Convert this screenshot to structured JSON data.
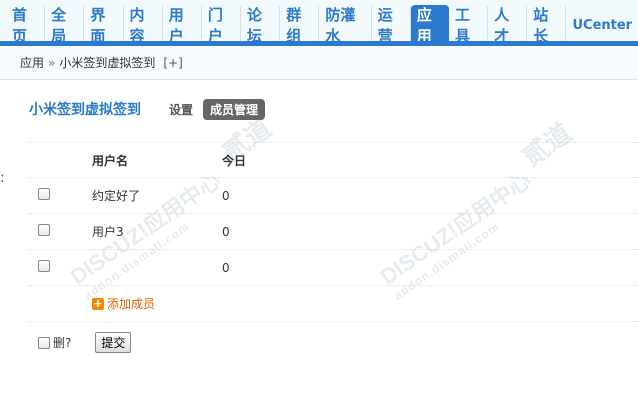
{
  "nav": {
    "tabs": [
      "首页",
      "全局",
      "界面",
      "内容",
      "用户",
      "门户",
      "论坛",
      "群组",
      "防灌水",
      "运营",
      "应用",
      "工具",
      "人才",
      "站长",
      "UCenter"
    ],
    "active_index": 10
  },
  "breadcrumb": {
    "root": "应用",
    "separator": "»",
    "current": "小米签到虚拟签到",
    "add": "[+]"
  },
  "header": {
    "title": "小米签到虚拟签到",
    "tabs": [
      "设置",
      "成员管理"
    ],
    "active_tab": "成员管理"
  },
  "table": {
    "columns": [
      "用户名",
      "今日"
    ],
    "rows": [
      {
        "username": "约定好了",
        "today": "0"
      },
      {
        "username": "用户3",
        "today": "0"
      },
      {
        "username": "",
        "today": "0"
      }
    ]
  },
  "add_member": "添加成员",
  "footer": {
    "delete_label": "删?",
    "submit_label": "提交"
  },
  "watermark": {
    "brand": "DISCUZ!应用中心",
    "domain": "addon.dismall.com",
    "mark": "贰道"
  },
  "colors": {
    "accent": "#2b7acd",
    "link_orange": "#e05f00"
  }
}
